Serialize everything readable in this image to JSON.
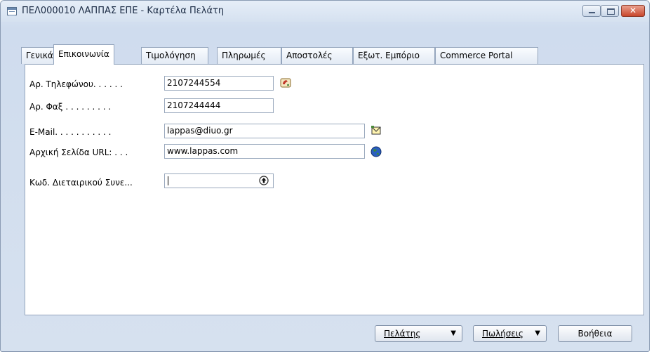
{
  "window": {
    "title": "ΠΕΛ000010 ΛΑΠΠΑΣ ΕΠΕ - Καρτέλα Πελάτη",
    "controls": {
      "close_glyph": "✕"
    }
  },
  "tabs": [
    {
      "label": "Γενικά"
    },
    {
      "label": "Επικοινωνία",
      "active": true
    },
    {
      "label": "Τιμολόγηση"
    },
    {
      "label": "Πληρωμές"
    },
    {
      "label": "Αποστολές"
    },
    {
      "label": "Εξωτ. Εμπόριο"
    },
    {
      "label": "Commerce Portal"
    }
  ],
  "form": {
    "phone": {
      "label": "Αρ. Τηλεφώνου. . . . . .",
      "value": "2107244554",
      "icon": "phone-dial-icon"
    },
    "fax": {
      "label": "Αρ. Φαξ . . . . . . . . .",
      "value": "2107244444"
    },
    "email": {
      "label": "E-Mail. . . . . . . . . . .",
      "value": "lappas@diuo.gr",
      "icon": "email-icon"
    },
    "homepage": {
      "label": "Αρχική Σελίδα URL: . . .",
      "value": "www.lappas.com",
      "icon": "globe-icon"
    },
    "partner_code": {
      "label": "Κωδ. Διεταιρικού Συνε...",
      "value": "",
      "icon": "lookup-up-arrow-icon"
    }
  },
  "buttons": {
    "customer": "Πελάτης",
    "sales": "Πωλήσεις",
    "help": "Βοήθεια"
  },
  "colors": {
    "accent": "#1f5fb4",
    "title_text": "#1b2b44"
  }
}
